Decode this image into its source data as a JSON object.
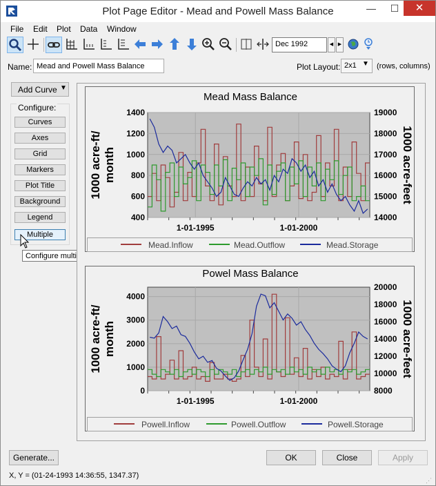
{
  "window": {
    "title": "Plot Page Editor - Mead and Powell Mass Balance",
    "min": "—",
    "max": "☐",
    "close": "✕"
  },
  "menu": [
    "File",
    "Edit",
    "Plot",
    "Data",
    "Window"
  ],
  "toolbar": {
    "date": "Dec 1992",
    "prev": "◀",
    "next": "▶"
  },
  "name_row": {
    "label": "Name:",
    "value": "Mead and Powell Mass Balance",
    "layout_label": "Plot Layout:",
    "layout_value": "2x1",
    "layout_hint": "(rows, columns)"
  },
  "sidebar": {
    "add_curve": "Add Curve",
    "configure_label": "Configure:",
    "buttons": [
      "Curves",
      "Axes",
      "Grid",
      "Markers",
      "Plot Title",
      "Background",
      "Legend",
      "Multiple"
    ],
    "tooltip": "Configure multiple plots and curves..."
  },
  "colors": {
    "inflow": "#a03c3c",
    "outflow": "#2d9a2d",
    "storage": "#1a2a9c",
    "plot_bg": "#c0c0c0"
  },
  "chart_data": [
    {
      "type": "line",
      "title": "Mead Mass Balance",
      "ylabel": "1000 acre-ft/ month",
      "y2label": "1000 acre-feet",
      "yticks": [
        "1400",
        "1200",
        "1000",
        "800",
        "600",
        "400"
      ],
      "y2ticks": [
        "19000",
        "18000",
        "17000",
        "16000",
        "15000",
        "14000"
      ],
      "xticks": [
        "1-01-1995",
        "1-01-2000"
      ],
      "ylim": [
        400,
        1400
      ],
      "y2lim": [
        14000,
        19000
      ],
      "x_range": [
        "1992-12",
        "2003-06"
      ],
      "grid": true,
      "legend_position": "bottom",
      "series": [
        {
          "name": "Mead.Inflow",
          "axis": "left",
          "values": [
            600,
            820,
            560,
            900,
            780,
            500,
            640,
            1020,
            560,
            830,
            600,
            920,
            1240,
            700,
            560,
            1100,
            520,
            980,
            700,
            600,
            1290,
            560,
            880,
            600,
            1080,
            720,
            560,
            1260,
            600,
            900,
            1010,
            560,
            700,
            1120,
            580,
            1000,
            560,
            640,
            1180,
            600,
            920,
            700,
            1240,
            560,
            880,
            600,
            1120,
            820,
            560,
            920
          ]
        },
        {
          "name": "Mead.Outflow",
          "axis": "left",
          "values": [
            500,
            900,
            760,
            460,
            830,
            920,
            600,
            880,
            720,
            780,
            940,
            560,
            900,
            830,
            620,
            900,
            700,
            950,
            560,
            870,
            760,
            920,
            600,
            880,
            800,
            960,
            520,
            900,
            620,
            840,
            920,
            560,
            880,
            720,
            940,
            600,
            880,
            700,
            920,
            560,
            860,
            760,
            940,
            620,
            800,
            880,
            560,
            600,
            700,
            560
          ]
        },
        {
          "name": "Mead.Storage",
          "axis": "right",
          "values": [
            18700,
            18300,
            17500,
            17100,
            17400,
            17200,
            16600,
            16800,
            17000,
            16600,
            16300,
            16600,
            16000,
            15700,
            15400,
            15000,
            15200,
            15900,
            15500,
            15100,
            15000,
            15400,
            15700,
            15500,
            15900,
            15600,
            15800,
            15300,
            16000,
            15700,
            16300,
            16100,
            16800,
            16600,
            16200,
            16500,
            15900,
            16200,
            15500,
            15800,
            15200,
            15600,
            15100,
            14800,
            15000,
            14600,
            14300,
            14800,
            14200,
            14400
          ]
        }
      ]
    },
    {
      "type": "line",
      "title": "Powel Mass Balance",
      "ylabel": "1000 acre-ft/ month",
      "y2label": "1000 acre-feet",
      "yticks": [
        "4000",
        "3000",
        "2000",
        "1000",
        "0"
      ],
      "y2ticks": [
        "20000",
        "18000",
        "16000",
        "14000",
        "12000",
        "10000",
        "8000"
      ],
      "xticks": [
        "1-01-1995",
        "1-01-2000"
      ],
      "ylim": [
        0,
        4400
      ],
      "y2lim": [
        8000,
        20000
      ],
      "x_range": [
        "1992-12",
        "2003-06"
      ],
      "grid": true,
      "legend_position": "bottom",
      "series": [
        {
          "name": "Powell.Inflow",
          "axis": "left",
          "values": [
            600,
            500,
            2300,
            500,
            700,
            1300,
            500,
            1700,
            500,
            600,
            1000,
            500,
            600,
            400,
            1200,
            500,
            500,
            700,
            500,
            400,
            500,
            1500,
            600,
            3000,
            1000,
            600,
            2200,
            500,
            4100,
            800,
            600,
            3100,
            700,
            1400,
            600,
            1800,
            500,
            900,
            600,
            1000,
            500,
            700,
            600,
            2100,
            500,
            900,
            2500,
            500,
            600,
            700
          ]
        },
        {
          "name": "Powell.Outflow",
          "axis": "right_scaled",
          "values": [
            900,
            700,
            600,
            900,
            800,
            700,
            900,
            600,
            800,
            900,
            700,
            900,
            800,
            600,
            900,
            700,
            900,
            800,
            700,
            900,
            600,
            800,
            900,
            700,
            900,
            800,
            1000,
            700,
            900,
            800,
            900,
            700,
            1000,
            800,
            900,
            700,
            1000,
            800,
            900,
            700,
            1000,
            800,
            900,
            700,
            900,
            800,
            900,
            700,
            800,
            900
          ]
        },
        {
          "name": "Powell.Storage",
          "axis": "right",
          "values": [
            14200,
            14100,
            14700,
            16600,
            16000,
            15200,
            15500,
            14500,
            14300,
            13500,
            12500,
            11700,
            12000,
            11300,
            11500,
            10600,
            10300,
            9700,
            9200,
            9500,
            10300,
            11600,
            12800,
            14600,
            17800,
            19200,
            19000,
            17600,
            18200,
            17200,
            16200,
            16900,
            16400,
            15600,
            16000,
            15100,
            14400,
            13500,
            12800,
            12300,
            11700,
            10900,
            10500,
            10200,
            10900,
            12400,
            13500,
            14800,
            14300,
            14000
          ]
        }
      ]
    }
  ],
  "footer": {
    "generate": "Generate...",
    "ok": "OK",
    "close": "Close",
    "apply": "Apply",
    "status": "X, Y = (01-24-1993 14:36:55, 1347.37)"
  }
}
